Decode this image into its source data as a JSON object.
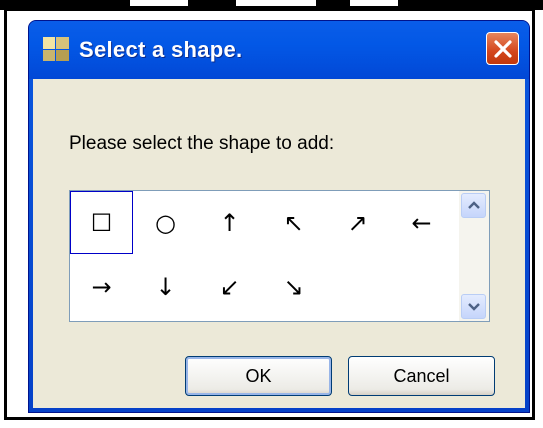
{
  "window": {
    "title": "Select a shape.",
    "close_icon": "close-icon"
  },
  "prompt": "Please select the shape to add:",
  "shapes": [
    {
      "glyph": "☐",
      "icon": "square-shape-icon",
      "selected": true
    },
    {
      "glyph": "○",
      "icon": "circle-shape-icon",
      "selected": false
    },
    {
      "glyph": "↑",
      "icon": "arrow-up-icon",
      "selected": false
    },
    {
      "glyph": "↖",
      "icon": "arrow-up-left-icon",
      "selected": false
    },
    {
      "glyph": "↗",
      "icon": "arrow-up-right-icon",
      "selected": false
    },
    {
      "glyph": "←",
      "icon": "arrow-left-icon",
      "selected": false
    },
    {
      "glyph": "→",
      "icon": "arrow-right-icon",
      "selected": false
    },
    {
      "glyph": "↓",
      "icon": "arrow-down-icon",
      "selected": false
    },
    {
      "glyph": "↙",
      "icon": "arrow-down-left-icon",
      "selected": false
    },
    {
      "glyph": "↘",
      "icon": "arrow-down-right-icon",
      "selected": false
    }
  ],
  "buttons": {
    "ok": "OK",
    "cancel": "Cancel"
  },
  "colors": {
    "titlebar": "#0358e6",
    "client": "#ece9d8",
    "close_button": "#d4461c",
    "selection_border": "#0000c8"
  }
}
